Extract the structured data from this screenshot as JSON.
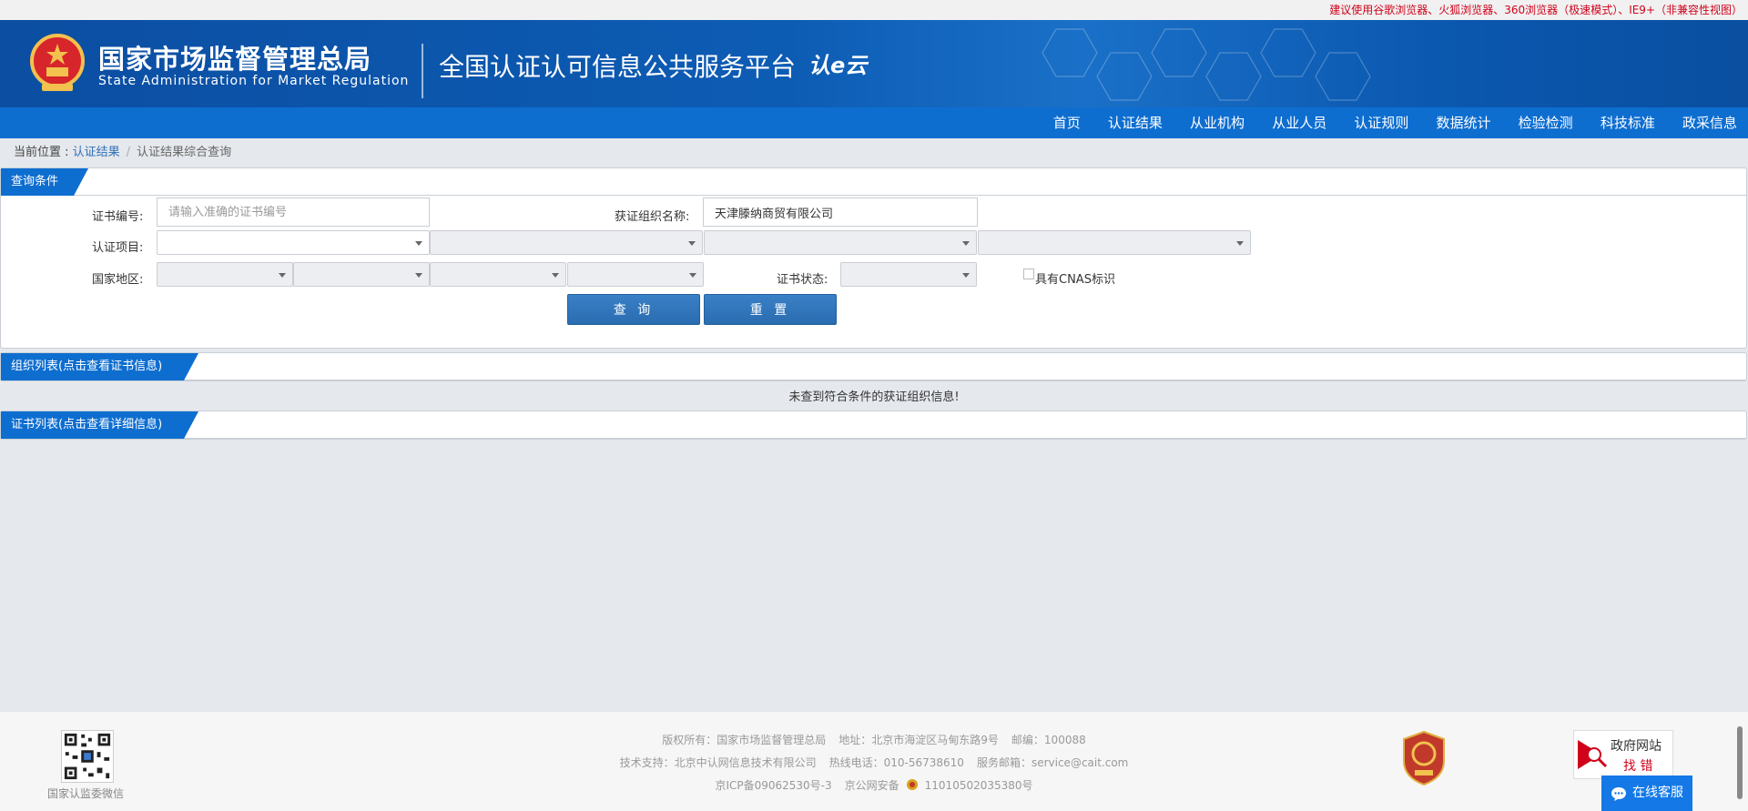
{
  "topbar": {
    "notice": "建议使用谷歌浏览器、火狐浏览器、360浏览器（极速模式）、IE9+（非兼容性视图）"
  },
  "header": {
    "agency_cn": "国家市场监督管理总局",
    "agency_en": "State Administration  for  Market Regulation",
    "platform": "全国认证认可信息公共服务平台",
    "logo_text": "认e云"
  },
  "nav": {
    "items": [
      "首页",
      "认证结果",
      "从业机构",
      "从业人员",
      "认证规则",
      "数据统计",
      "检验检测",
      "科技标准",
      "政采信息"
    ]
  },
  "breadcrumb": {
    "prefix": "当前位置 : ",
    "parent": "认证结果",
    "current": "认证结果综合查询"
  },
  "query_panel": {
    "title": "查询条件",
    "cert_no_label": "证书编号:",
    "cert_no_placeholder": "请输入准确的证书编号",
    "org_name_label": "获证组织名称:",
    "org_name_value": "天津滕纳商贸有限公司",
    "project_label": "认证项目:",
    "region_label": "国家地区:",
    "status_label": "证书状态:",
    "cnas_label": "具有CNAS标识",
    "query_button": "查 询",
    "reset_button": "重 置"
  },
  "org_panel": {
    "title": "组织列表(点击查看证书信息)",
    "empty_message": "未查到符合条件的获证组织信息!"
  },
  "cert_panel": {
    "title": "证书列表(点击查看详细信息)"
  },
  "footer": {
    "qr_caption": "国家认监委微信",
    "line1": [
      "版权所有：国家市场监督管理总局",
      "地址：北京市海淀区马甸东路9号",
      "邮编：100088"
    ],
    "line2": [
      "技术支持：北京中认网信息技术有限公司",
      "热线电话：010-56738610",
      "服务邮箱：service@cait.com"
    ],
    "line3": [
      "京ICP备09062530号-3",
      "京公网安备",
      "11010502035380号"
    ],
    "gov_error_line1": "政府网站",
    "gov_error_line2": "找 错",
    "online_service": "在线客服"
  },
  "colors": {
    "header_blue": "#0b4ea2",
    "nav_blue": "#0e6ed0",
    "tab_blue": "#0e6ed0",
    "notice_red": "#d0021b"
  }
}
